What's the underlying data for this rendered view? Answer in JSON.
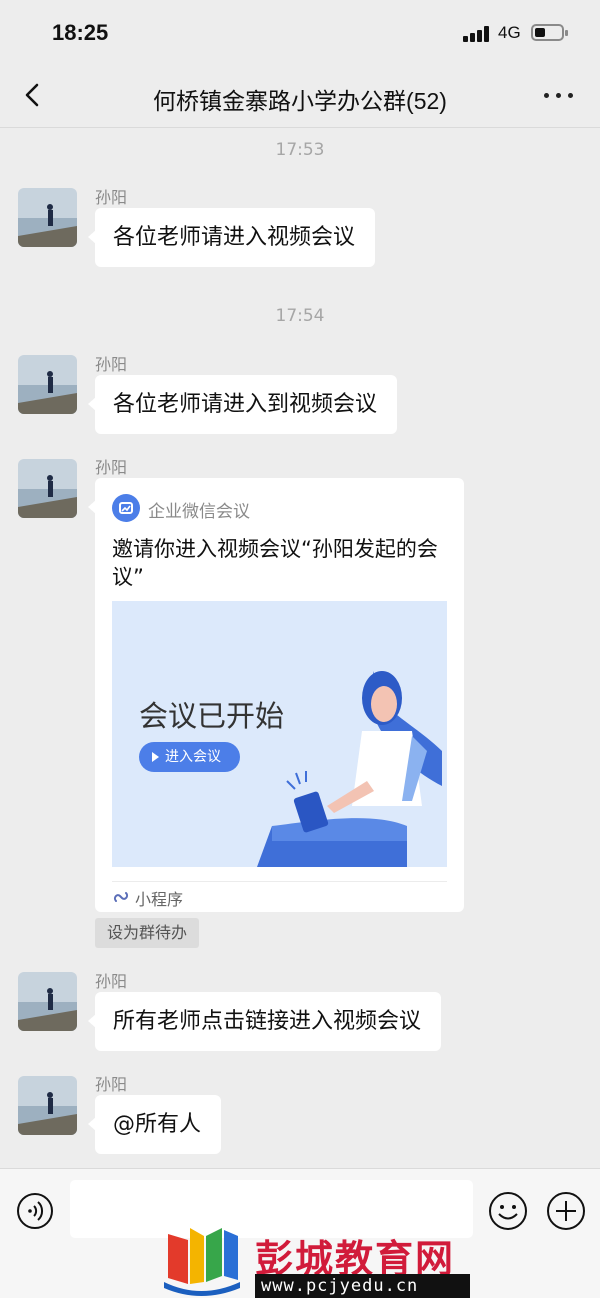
{
  "status_bar": {
    "time": "18:25",
    "network": "4G"
  },
  "header": {
    "title": "何桥镇金寨路小学办公群(52)"
  },
  "chat": {
    "timestamps": [
      "17:53",
      "17:54"
    ],
    "messages": [
      {
        "sender": "孙阳",
        "text": "各位老师请进入视频会议"
      },
      {
        "sender": "孙阳",
        "text": "各位老师请进入到视频会议"
      },
      {
        "sender": "孙阳",
        "card": {
          "source": "企业微信会议",
          "title": "邀请你进入视频会议“孙阳发起的会议”",
          "image_text": "会议已开始",
          "button": "进入会议",
          "footer": "小程序"
        },
        "tag": "设为群待办"
      },
      {
        "sender": "孙阳",
        "text": "所有老师点击链接进入视频会议"
      },
      {
        "sender": "孙阳",
        "text": "@所有人"
      }
    ]
  },
  "input": {
    "placeholder": ""
  },
  "watermark": {
    "title": "彭城教育网",
    "url": "www.pcjyedu.cn"
  },
  "colors": {
    "accent": "#4c7ee8",
    "background": "#ededed",
    "watermark": "#d11b3a"
  }
}
